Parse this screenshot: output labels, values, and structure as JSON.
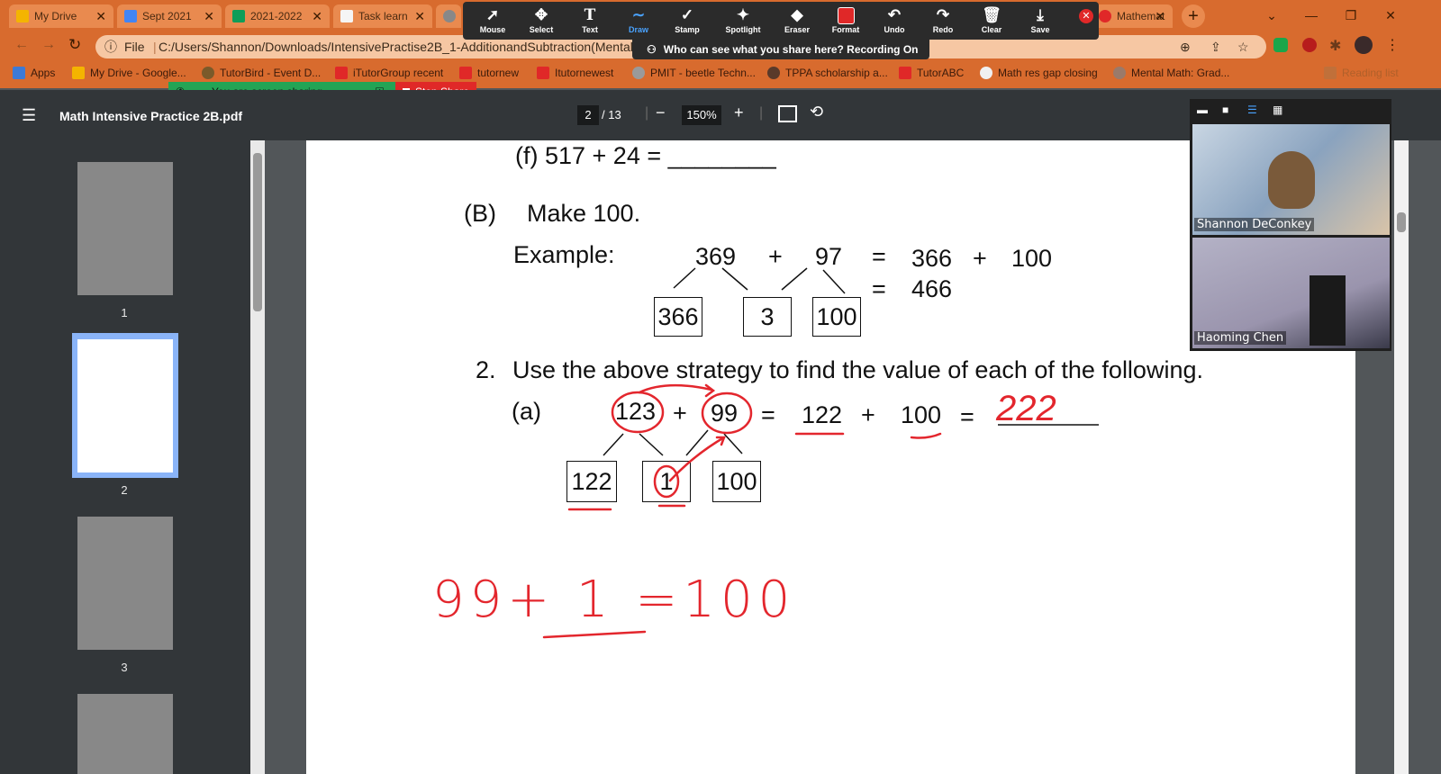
{
  "browser": {
    "tabs": [
      {
        "title": "My Drive",
        "color": "#f4b400"
      },
      {
        "title": "Sept 2021",
        "color": "#4285f4"
      },
      {
        "title": "2021-2022",
        "color": "#0f9d58"
      },
      {
        "title": "Task learn",
        "color": "#f5f5f5"
      },
      {
        "title": "",
        "color": "#888888"
      },
      {
        "title": "Mathemat",
        "color": "#e07a3a"
      }
    ],
    "new_tab_symbol": "+",
    "url_prefix": "File",
    "url": "C:/Users/Shannon/Downloads/IntensivePractise2B_1-AdditionandSubtraction(MentalC",
    "bookmarks": [
      "Apps",
      "My Drive - Google...",
      "TutorBird - Event D...",
      "iTutorGroup recent",
      "tutornew",
      "Itutornewest",
      "PMIT - beetle Techn...",
      "TPPA scholarship a...",
      "TutorABC",
      "Math res gap closing",
      "Mental Math: Grad..."
    ],
    "reading_list": "Reading list"
  },
  "zoom": {
    "tools": [
      "Mouse",
      "Select",
      "Text",
      "Draw",
      "Stamp",
      "Spotlight",
      "Eraser",
      "Format",
      "Undo",
      "Redo",
      "Clear",
      "Save"
    ],
    "active_tool": "Draw",
    "recording_notice": "Who can see what you share here? Recording On",
    "sharing_text": "You are screen sharing",
    "stop_share": "Stop Share",
    "participants": [
      "Shannon DeConkey",
      "Haoming Chen"
    ]
  },
  "pdf": {
    "title": "Math Intensive Practice 2B.pdf",
    "page_current": "2",
    "page_total": "/ 13",
    "zoom": "150%",
    "thumb_numbers": [
      "1",
      "2",
      "3"
    ]
  },
  "content": {
    "line_f": "(f)   517 + 24 = ________",
    "section_b_label": "(B)",
    "section_b_title": "Make 100.",
    "example_label": "Example:",
    "ex_a": "369",
    "ex_plus": "+",
    "ex_b": "97",
    "ex_eq": "=",
    "ex_c": "366",
    "ex_plus2": "+",
    "ex_d": "100",
    "ex_eq2": "=",
    "ex_result": "466",
    "ex_boxes": [
      "366",
      "3",
      "100"
    ],
    "q2_num": "2.",
    "q2_text": "Use the above strategy to find the value of each of the following.",
    "qa_label": "(a)",
    "qa_a": "123",
    "qa_plus": "+",
    "qa_b": "99",
    "qa_eq": "=",
    "qa_c": "122",
    "qa_plus2": "+",
    "qa_d": "100",
    "qa_eq2": "=",
    "qa_answer": "222",
    "qa_boxes": [
      "122",
      "1",
      "100"
    ],
    "note": "99+ 1 =100"
  },
  "colors": {
    "ink": "#e3262d",
    "accent": "#d86b2e"
  }
}
